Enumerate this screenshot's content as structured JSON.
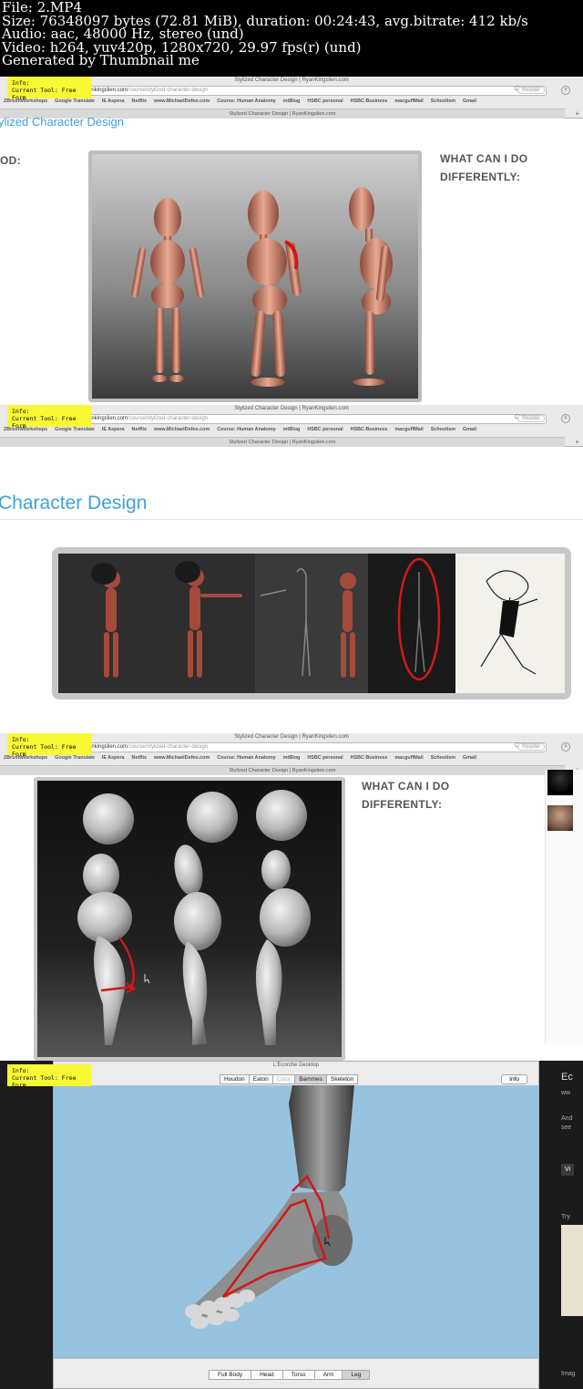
{
  "header": {
    "lines": [
      "File: 2.MP4",
      "Size: 76348097 bytes (72.81 MiB), duration: 00:24:43, avg.bitrate: 412 kb/s",
      "Audio: aac, 48000 Hz, stereo (und)",
      "Video: h264, yuv420p, 1280x720, 29.97 fps(r) (und)",
      "Generated by Thumbnail me"
    ]
  },
  "info_tag": {
    "line1": "Info:",
    "line2": "Current Tool: Free Form"
  },
  "browser": {
    "window_title": "Stylized Character Design | RyanKingslien.com",
    "url_host": "ankingslien.com",
    "url_path": "/course/stylized-character-design",
    "reader_label": "Reader",
    "reload_glyph": "C",
    "tab_title": "Stylized Character Design | RyanKingslien.com",
    "bookmarks": [
      "ZBrushWorkshops",
      "Google Translate",
      "IE Aspera",
      "Netflix",
      "www.MichaelDefeo.com",
      "Course: Human Anatomy",
      "mtBlog",
      "HSBC personal",
      "HSBC Business",
      "macguffMail",
      "Schoolism",
      "Gmail"
    ]
  },
  "frame1": {
    "page_title": "ylized Character Design",
    "left_label": "OD:",
    "right_label_1": "WHAT CAN I DO",
    "right_label_2": "DIFFERENTLY:"
  },
  "frame2": {
    "page_title": "Character Design"
  },
  "frame3": {
    "right_label_1": "WHAT CAN I DO",
    "right_label_2": "DIFFERENTLY:"
  },
  "frame4": {
    "window_title": "L'Ecorché Desktop",
    "top_tabs": [
      "Houdon",
      "Eaton",
      "Color",
      "Bammes",
      "Skeleton"
    ],
    "info_button": "Info",
    "bottom_tabs": [
      "Full Body",
      "Head",
      "Torso",
      "Arm",
      "Leg"
    ],
    "right_strip": {
      "t1": "Ec",
      "s1": "ww",
      "s2": "And",
      "s3": "see",
      "b1": "Vi",
      "s4": "Try",
      "s5": "Imag"
    }
  },
  "colors": {
    "accent": "#3fa2d8",
    "info_bg": "#f8f835",
    "annotation": "#d01818",
    "scene_bg": "#97c3e0"
  }
}
